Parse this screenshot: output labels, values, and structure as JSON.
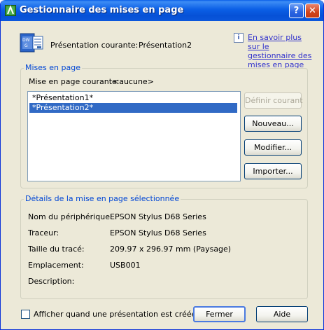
{
  "window": {
    "title": "Gestionnaire des mises en page",
    "help_label": "?",
    "close_label": "✕"
  },
  "header": {
    "current_layout_label": "Présentation courante:",
    "current_layout_value": "Présentation2",
    "info_icon": "i",
    "help_link": "En savoir plus sur le gestionnaire des mises en page"
  },
  "page_setups": {
    "title": "Mises en page",
    "current_label": "Mise en page courante:",
    "current_value": "<aucune>",
    "items": [
      {
        "label": "*Présentation1*",
        "selected": false
      },
      {
        "label": "*Présentation2*",
        "selected": true
      }
    ],
    "buttons": {
      "set_current": "Définir courant",
      "new": "Nouveau...",
      "modify": "Modifier...",
      "import": "Importer..."
    }
  },
  "details": {
    "title": "Détails de la mise en page sélectionnée",
    "rows": [
      {
        "label": "Nom du périphérique:",
        "value": "EPSON Stylus D68 Series"
      },
      {
        "label": "Traceur:",
        "value": "EPSON Stylus D68 Series"
      },
      {
        "label": "Taille du tracé:",
        "value": "209.97 x 296.97 mm (Paysage)"
      },
      {
        "label": "Emplacement:",
        "value": "USB001"
      },
      {
        "label": "Description:",
        "value": ""
      }
    ]
  },
  "footer": {
    "checkbox_label": "Afficher quand une présentation est créée",
    "checkbox_checked": false,
    "close_button": "Fermer",
    "help_button": "Aide"
  },
  "colors": {
    "title_bar": "#0a5fe8",
    "group_title": "#0046d5",
    "selection": "#316ac5",
    "link": "#3333cc"
  }
}
